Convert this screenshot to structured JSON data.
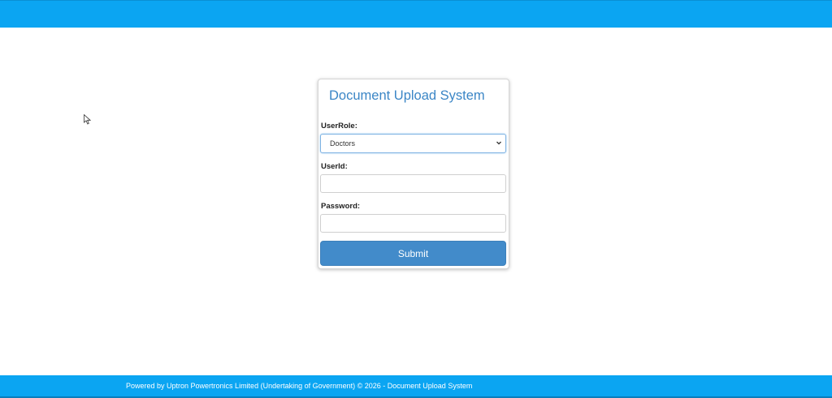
{
  "colors": {
    "header": "#0ba5f2",
    "title": "#3b86c6",
    "button": "#428bca",
    "footer": "#0ba5f2"
  },
  "login": {
    "title": "Document Upload System",
    "role_label": "UserRole:",
    "role_value": "Doctors",
    "userid_label": "UserId:",
    "userid_value": "",
    "password_label": "Password:",
    "password_value": "",
    "submit_label": "Submit"
  },
  "footer": {
    "text": "Powered by Uptron Powertronics Limited (Undertaking of Government) © 2026 - Document Upload System"
  },
  "icons": {
    "select_chevron": "chevron-down-icon",
    "cursor": "mouse-pointer-icon"
  }
}
